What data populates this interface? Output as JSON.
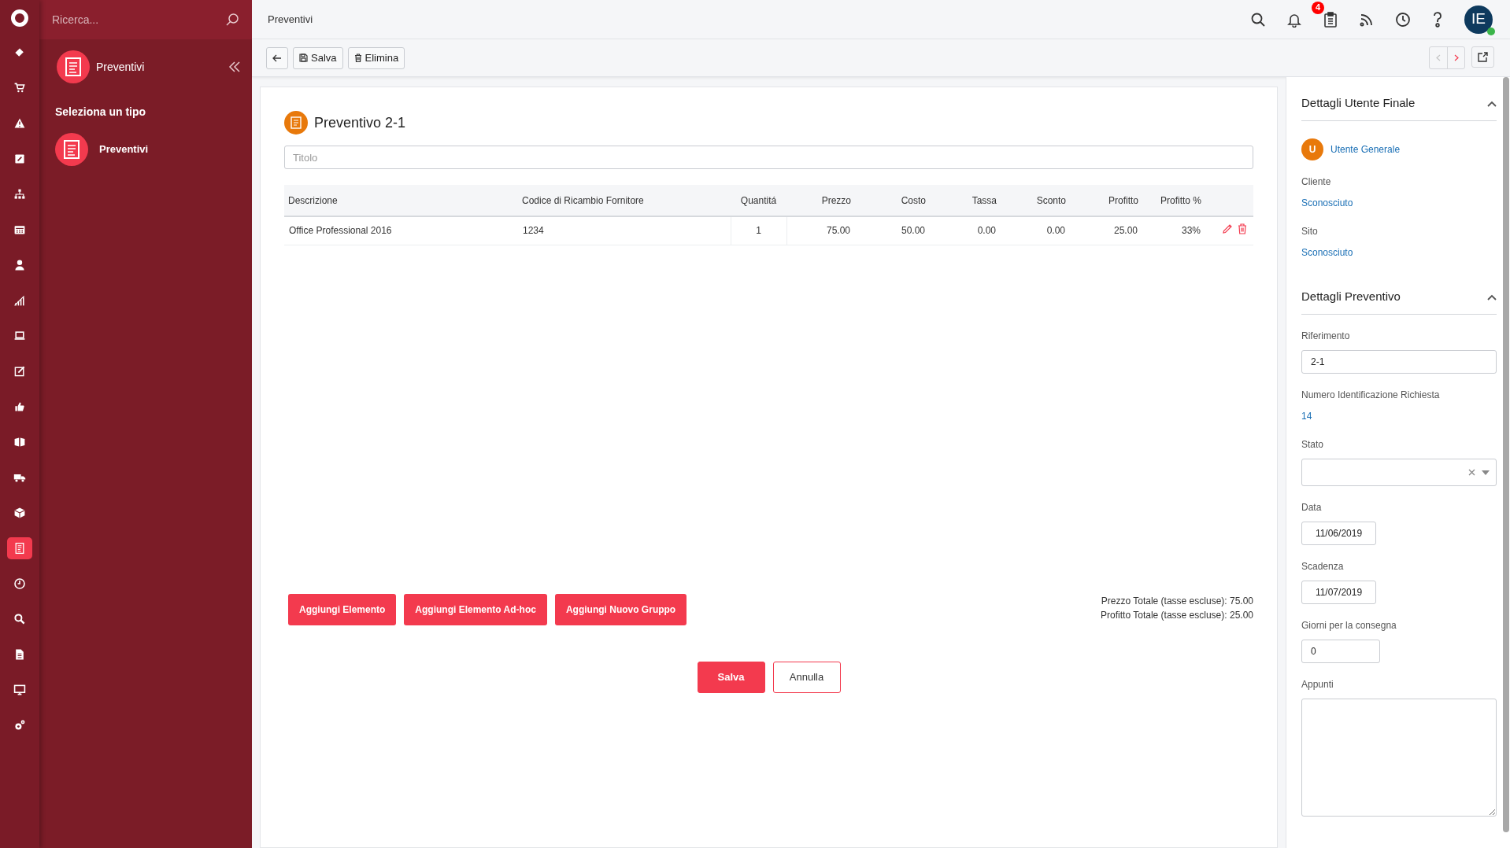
{
  "rail": {
    "items": [
      {
        "selected": false
      },
      {
        "selected": false
      },
      {
        "selected": false
      },
      {
        "selected": false
      },
      {
        "selected": false
      },
      {
        "selected": false
      },
      {
        "selected": false
      },
      {
        "selected": false
      },
      {
        "selected": false
      },
      {
        "selected": false
      },
      {
        "selected": false
      },
      {
        "selected": false
      },
      {
        "selected": false
      },
      {
        "selected": false
      },
      {
        "selected": true
      },
      {
        "selected": false
      },
      {
        "selected": false
      },
      {
        "selected": false
      },
      {
        "selected": false
      },
      {
        "selected": false
      }
    ]
  },
  "search": {
    "placeholder": "Ricerca..."
  },
  "module": {
    "title": "Preventivi"
  },
  "type_picker": {
    "heading": "Seleziona un tipo",
    "items": [
      {
        "label": "Preventivi"
      }
    ]
  },
  "topbar": {
    "title": "Preventivi",
    "notification_count": "4",
    "avatar_initials": "IE",
    "online": true
  },
  "toolbar": {
    "buttons": [
      {
        "label": "Salva",
        "kind": "save"
      },
      {
        "label": "Elimina",
        "kind": "delete"
      }
    ],
    "prev": {
      "disabled": true
    },
    "next": {
      "disabled": false
    }
  },
  "quote": {
    "title": "Preventivo 2-1",
    "title_field": {
      "placeholder": "Titolo"
    },
    "table": {
      "columns": [
        "Descrizione",
        "Codice di Ricambio Fornitore",
        "Quantitá",
        "Prezzo",
        "Costo",
        "Tassa",
        "Sconto",
        "Profitto",
        "Profitto %"
      ],
      "rows": [
        {
          "cells": [
            "Office Professional 2016",
            "1234",
            "1",
            "75.00",
            "50.00",
            "0.00",
            "0.00",
            "25.00",
            "33%"
          ]
        }
      ]
    },
    "add_buttons": [
      "Aggiungi Elemento",
      "Aggiungi Elemento Ad-hoc",
      "Aggiungi Nuovo Gruppo"
    ],
    "totals": [
      "Prezzo Totale (tasse escluse): 75.00",
      "Profitto Totale (tasse escluse): 25.00"
    ],
    "actions": [
      {
        "label": "Salva",
        "kind": "primary"
      },
      {
        "label": "Annulla",
        "kind": "secondary"
      }
    ]
  },
  "details": {
    "sections": [
      {
        "title": "Dettagli Utente Finale",
        "expanded": true,
        "fields": [
          {
            "kind": "user",
            "initial": "U",
            "value": "Utente Generale"
          },
          {
            "kind": "link",
            "label": "Cliente",
            "value": "Sconosciuto"
          },
          {
            "kind": "link",
            "label": "Sito",
            "value": "Sconosciuto"
          }
        ]
      },
      {
        "title": "Dettagli Preventivo",
        "expanded": true,
        "fields": [
          {
            "kind": "input",
            "label": "Riferimento",
            "value": "2-1"
          },
          {
            "kind": "link",
            "label": "Numero Identificazione Richiesta",
            "value": "14"
          },
          {
            "kind": "select",
            "label": "Stato"
          },
          {
            "kind": "date",
            "label": "Data",
            "value": "11/06/2019"
          },
          {
            "kind": "date",
            "label": "Scadenza",
            "value": "11/07/2019"
          },
          {
            "kind": "number",
            "label": "Giorni per la consegna",
            "value": "0"
          },
          {
            "kind": "textarea",
            "label": "Appunti"
          }
        ]
      }
    ]
  }
}
